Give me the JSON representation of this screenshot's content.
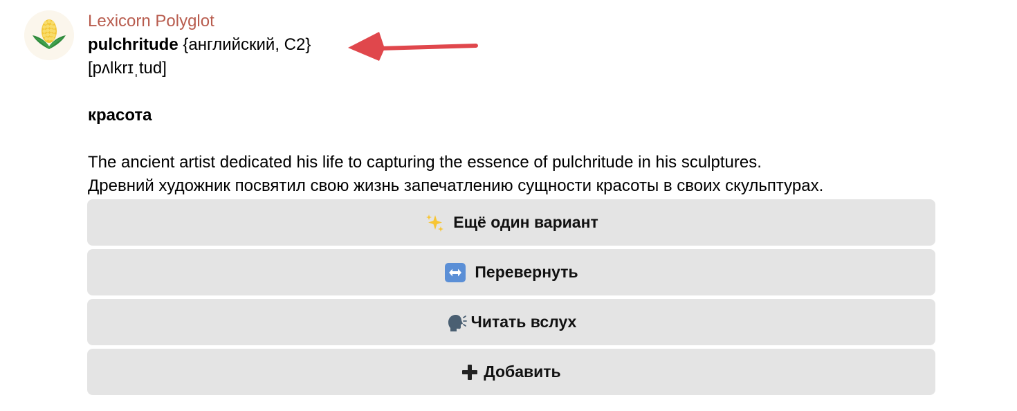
{
  "sender": "Lexicorn Polyglot",
  "card": {
    "word": "pulchritude",
    "meta": "{английский, C2}",
    "transcription": "[pʌlkrɪˌtud]",
    "translation": "красота",
    "example_en": "The ancient artist dedicated his life to capturing the essence of pulchritude in his sculptures.",
    "example_ru": "Древний художник посвятил свою жизнь запечатлению сущности красоты в своих скульптурах."
  },
  "buttons": [
    {
      "icon": "sparkles-icon",
      "label": "Ещё один вариант"
    },
    {
      "icon": "left-right-arrow-icon",
      "label": "Перевернуть"
    },
    {
      "icon": "speaking-head-icon",
      "label": "Читать вслух"
    },
    {
      "icon": "plus-icon",
      "label": "Добавить"
    }
  ],
  "colors": {
    "sender": "#b85c4e",
    "button_bg": "#e4e4e4",
    "annotation_arrow": "#e0474c"
  }
}
